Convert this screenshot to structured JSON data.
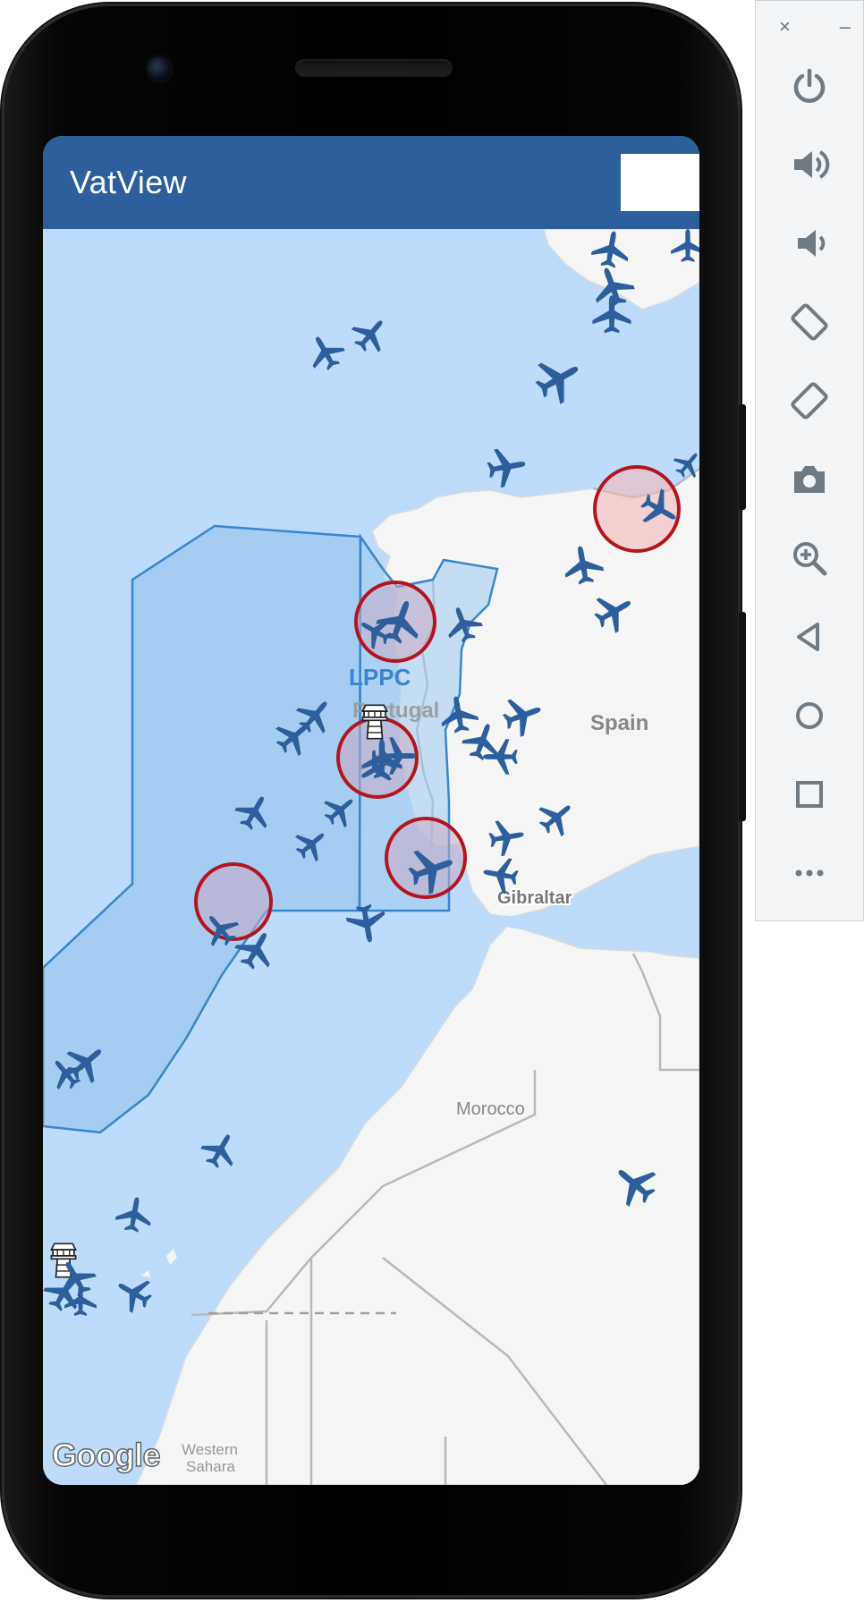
{
  "app": {
    "title": "VatView"
  },
  "map": {
    "labels": {
      "fir": "LPPC",
      "portugal": "Portugal",
      "spain": "Spain",
      "gibraltar": "Gibraltar",
      "morocco": "Morocco",
      "western_sahara_1": "Western",
      "western_sahara_2": "Sahara"
    },
    "attribution": "Google",
    "colors": {
      "sea": "#bddcfb",
      "land": "#f5f5f5",
      "fir_fill": "#9cc8ee",
      "fir_stroke": "#3a86cc",
      "aircraft": "#2c5f9b",
      "airport_circle": "#b3151d"
    }
  },
  "emulator": {
    "close": "×",
    "minimize": "–",
    "buttons": [
      "power-icon",
      "volume-up-icon",
      "volume-down-icon",
      "rotate-left-icon",
      "rotate-right-icon",
      "camera-icon",
      "zoom-icon",
      "back-icon",
      "home-icon",
      "overview-icon",
      "more-icon"
    ]
  }
}
